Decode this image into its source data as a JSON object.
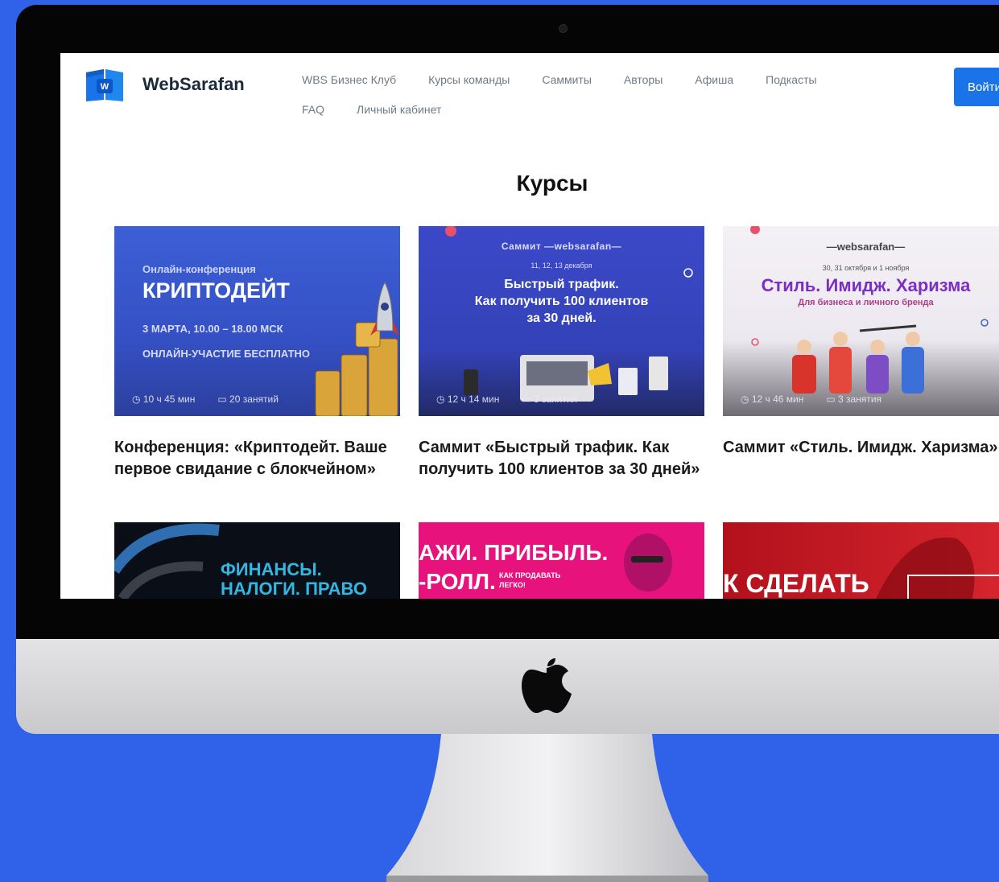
{
  "brand": {
    "name": "WebSarafan",
    "logo_letter": "W"
  },
  "nav": {
    "row1": [
      "WBS Бизнес Клуб",
      "Курсы команды",
      "Саммиты",
      "Авторы",
      "Афиша",
      "Подкасты"
    ],
    "row2": [
      "FAQ",
      "Личный кабинет"
    ]
  },
  "login_label": "Войти",
  "section_title": "Курсы",
  "cards": [
    {
      "title": "Конференция: «Криптодейт. Ваше первое свидание с блокчейном»",
      "kicker": "Онлайн-конференция",
      "headline": "КРИПТОДЕЙТ",
      "line1": "3 МАРТА, 10.00 – 18.00 МСК",
      "line2": "ОНЛАЙН-УЧАСТИЕ БЕСПЛАТНО",
      "duration": "10 ч 45 мин",
      "lessons": "20 занятий"
    },
    {
      "title": "Саммит «Быстрый трафик. Как получить 100 клиентов за 30 дней»",
      "kicker": "Саммит —websarafan—",
      "dates": "11, 12, 13 декабря",
      "headline1": "Быстрый трафик.",
      "headline2": "Как получить 100 клиентов",
      "headline3": "за 30 дней.",
      "duration": "12 ч 14 мин",
      "lessons": "3 занятия"
    },
    {
      "title": "Саммит «Стиль. Имидж. Харизма»",
      "kicker": "—websarafan—",
      "dates": "30, 31 октября и 1 ноября",
      "headline": "Стиль. Имидж. Харизма",
      "subline": "Для бизнеса и личного бренда",
      "duration": "12 ч 46 мин",
      "lessons": "3 занятия"
    }
  ],
  "banners": [
    {
      "line1": "ФИНАНСЫ.",
      "line2": "НАЛОГИ. ПРАВО"
    },
    {
      "line1": "АЖИ. ПРИБЫЛЬ.",
      "line2": "-РОЛЛ.",
      "small1": "КАК ПРОДАВАТЬ",
      "small2": "ЛЕГКО!"
    },
    {
      "line1": "К СДЕЛАТЬ"
    }
  ],
  "colors": {
    "background": "#2f62e8",
    "accent": "#1a73e8",
    "card1_bg": "#3a5bd0",
    "card2_bg": "#3946c4",
    "card3_bg": "#f1eef4",
    "banner2": "#e8127d",
    "banner3": "#b7121d"
  },
  "icons": [
    "clock-icon",
    "book-icon",
    "apple-logo-icon"
  ]
}
